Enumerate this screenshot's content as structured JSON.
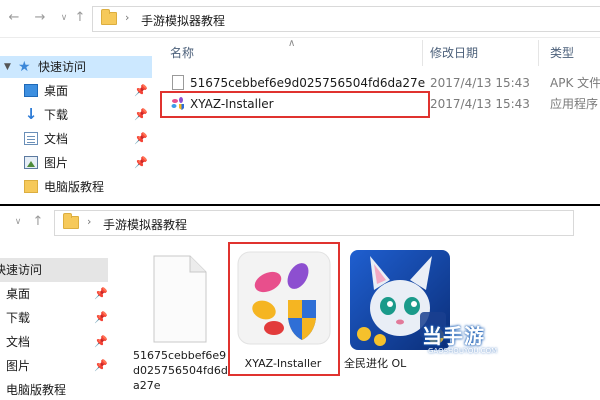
{
  "top": {
    "path": "手游模拟器教程",
    "nav_items": [
      {
        "label": "快速访问",
        "icon": "star-icon"
      },
      {
        "label": "桌面",
        "icon": "desktop-icon"
      },
      {
        "label": "下载",
        "icon": "download-icon"
      },
      {
        "label": "文档",
        "icon": "document-icon"
      },
      {
        "label": "图片",
        "icon": "picture-icon"
      },
      {
        "label": "电脑版教程",
        "icon": "folder-icon"
      }
    ],
    "columns": {
      "name": "名称",
      "date": "修改日期",
      "type": "类型"
    },
    "files": [
      {
        "name": "51675cebbef6e9d025756504fd6da27e",
        "date": "2017/4/13 15:43",
        "type": "APK 文件",
        "icon": "file-icon"
      },
      {
        "name": "XYAZ-Installer",
        "date": "2017/4/13 15:43",
        "type": "应用程序",
        "icon": "xyaz-app-icon"
      }
    ]
  },
  "bottom": {
    "path": "手游模拟器教程",
    "nav_items": [
      {
        "label": "快速访问"
      },
      {
        "label": "桌面"
      },
      {
        "label": "下载"
      },
      {
        "label": "文档"
      },
      {
        "label": "图片"
      },
      {
        "label": "电脑版教程"
      }
    ],
    "tiles": [
      {
        "label": "51675cebbef6e9d025756504fd6da27e",
        "icon": "file-icon"
      },
      {
        "label": "XYAZ-Installer",
        "icon": "xyaz-app-icon"
      },
      {
        "label": "全民进化 OL",
        "icon": "game-app-icon"
      }
    ],
    "watermark": {
      "brand": "当手游",
      "url": "GAOSHOUYOU.COM"
    }
  },
  "colors": {
    "highlight": "#e0332f",
    "selected_nav": "#cce8ff"
  }
}
